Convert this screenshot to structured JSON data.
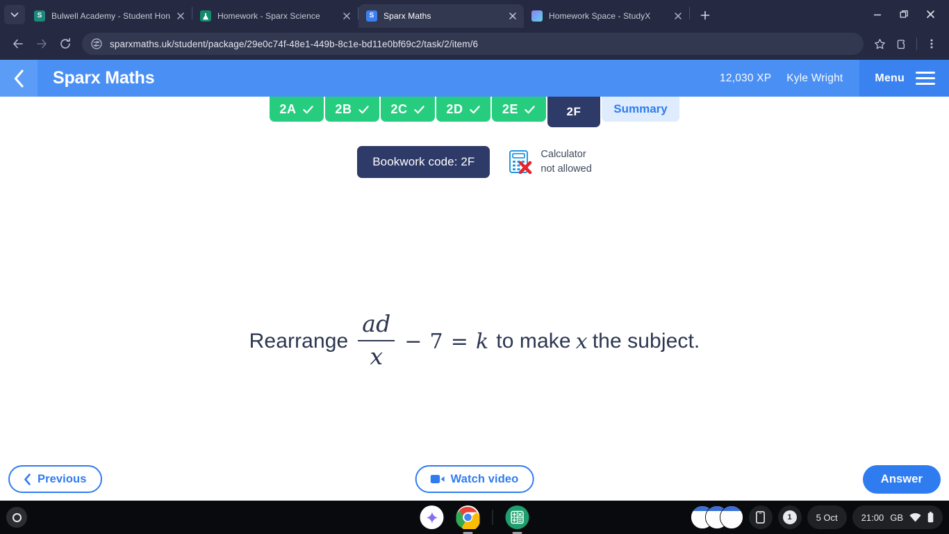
{
  "browser": {
    "tabs": [
      {
        "title": "Bulwell Academy - Student Hon",
        "favicon": "sharepoint-icon",
        "active": false
      },
      {
        "title": "Homework - Sparx Science",
        "favicon": "flask-icon",
        "active": false
      },
      {
        "title": "Sparx Maths",
        "favicon": "sparx-icon",
        "active": true
      },
      {
        "title": "Homework Space - StudyX",
        "favicon": "studyx-icon",
        "active": false
      }
    ],
    "new_tab_label": "+",
    "window_controls": {
      "minimize": "minimize-icon",
      "maximize": "restore-icon",
      "close": "close-icon"
    },
    "omnibox": {
      "url": "sparxmaths.uk/student/package/29e0c74f-48e1-449b-8c1e-bd11e0bf69c2/task/2/item/6",
      "site_settings_icon": "site-settings-icon",
      "bookmark_icon": "star-icon",
      "extensions_icon": "extensions-icon",
      "menu_icon": "kebab-menu-icon"
    },
    "nav": {
      "back": "back-arrow-icon",
      "forward": "forward-arrow-icon",
      "reload": "reload-icon"
    }
  },
  "sparx": {
    "header": {
      "back_icon": "chevron-left-icon",
      "brand": "Sparx Maths",
      "xp": "12,030 XP",
      "user": "Kyle Wright",
      "menu_label": "Menu",
      "menu_icon": "hamburger-icon"
    },
    "task_tabs": [
      {
        "label": "2A",
        "state": "done"
      },
      {
        "label": "2B",
        "state": "done"
      },
      {
        "label": "2C",
        "state": "done"
      },
      {
        "label": "2D",
        "state": "done"
      },
      {
        "label": "2E",
        "state": "done"
      },
      {
        "label": "2F",
        "state": "current"
      },
      {
        "label": "Summary",
        "state": "summary"
      }
    ],
    "bookwork_code": "Bookwork code: 2F",
    "calculator": {
      "icon": "calculator-not-allowed-icon",
      "line1": "Calculator",
      "line2": "not allowed"
    },
    "question": {
      "lead": "Rearrange",
      "fraction_numerator": "ad",
      "fraction_denominator": "x",
      "operator": "−",
      "operand": "7",
      "equals": "=",
      "right_side": "k",
      "middle_text": "to make",
      "subject": "x",
      "tail_text": "the subject.",
      "full_text": "Rearrange ad/x − 7 = k to make x the subject."
    },
    "footer": {
      "previous_label": "Previous",
      "previous_icon": "chevron-left-icon",
      "watch_video_label": "Watch video",
      "watch_video_icon": "video-camera-icon",
      "answer_label": "Answer"
    },
    "colors": {
      "header_blue": "#4a90f4",
      "menu_blue": "#3a82ef",
      "tab_green": "#27cd7f",
      "navy": "#2e3a67",
      "accent_blue": "#2f7cf0",
      "summary_bg": "#dfecfd"
    }
  },
  "shelf": {
    "launcher_icon": "launcher-icon",
    "apps": [
      {
        "name": "gemini-icon"
      },
      {
        "name": "chrome-icon"
      },
      {
        "name": "sparx-calculator-icon"
      }
    ],
    "tray": {
      "window_previews_icon": "window-previews-icon",
      "phone_hub_icon": "phone-hub-icon",
      "notification_count": "1",
      "date": "5 Oct",
      "time": "21:00",
      "locale": "GB",
      "wifi_icon": "wifi-icon",
      "battery_icon": "battery-icon"
    }
  }
}
